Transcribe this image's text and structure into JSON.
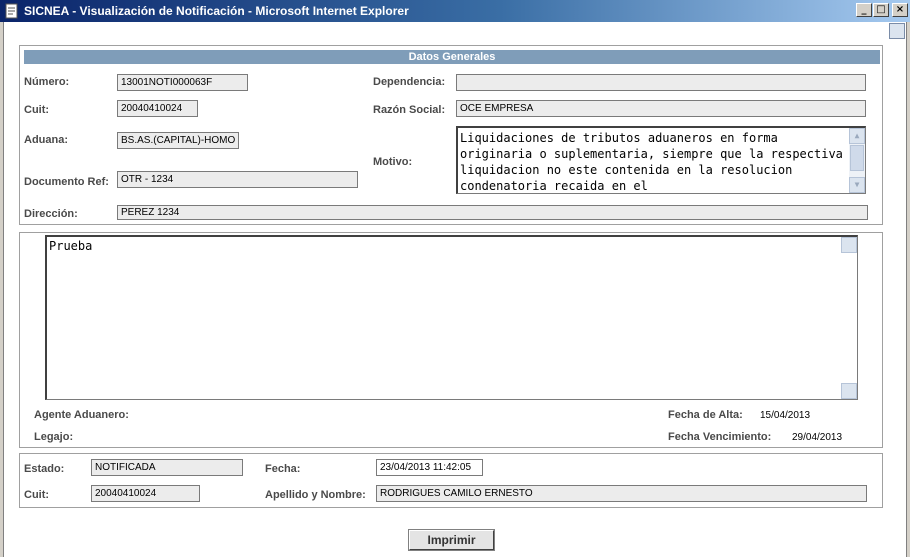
{
  "window": {
    "title": "SICNEA - Visualización de Notificación - Microsoft Internet Explorer",
    "controls": [
      "_",
      "□",
      "×"
    ]
  },
  "general": {
    "header": "Datos Generales",
    "numero_label": "Número:",
    "numero_value": "13001NOTI000063F",
    "dependencia_label": "Dependencia:",
    "dependencia_value": "",
    "cuit_label": "Cuit:",
    "cuit_value": "20040410024",
    "razon_social_label": "Razón Social:",
    "razon_social_value": "OCE EMPRESA",
    "aduana_label": "Aduana:",
    "aduana_value": "BS.AS.(CAPITAL)-HOMO",
    "motivo_label": "Motivo:",
    "motivo_value": "Liquidaciones de tributos aduaneros en forma originaria o suplementaria, siempre que la respectiva liquidacion no este contenida en la resolucion condenatoria recaida en el",
    "documento_ref_label": "Documento Ref:",
    "documento_ref_value": "OTR  -  1234",
    "direccion_label": "Dirección:",
    "direccion_value": "PEREZ 1234"
  },
  "message": {
    "body": "Prueba",
    "agente_label": "Agente Aduanero:",
    "legajo_label": "Legajo:",
    "fecha_alta_label": "Fecha de Alta:",
    "fecha_alta_value": "15/04/2013",
    "fecha_venc_label": "Fecha Vencimiento:",
    "fecha_venc_value": "29/04/2013"
  },
  "status": {
    "estado_label": "Estado:",
    "estado_value": "NOTIFICADA",
    "fecha_label": "Fecha:",
    "fecha_value": "23/04/2013 11:42:05",
    "cuit_label": "Cuit:",
    "cuit_value": "20040410024",
    "apellido_label": "Apellido y Nombre:",
    "apellido_value": "RODRIGUES CAMILO ERNESTO"
  },
  "actions": {
    "print_label": "Imprimir"
  },
  "colors": {
    "header_bar": "#7f9db9",
    "title_bar": "#0a246a"
  }
}
